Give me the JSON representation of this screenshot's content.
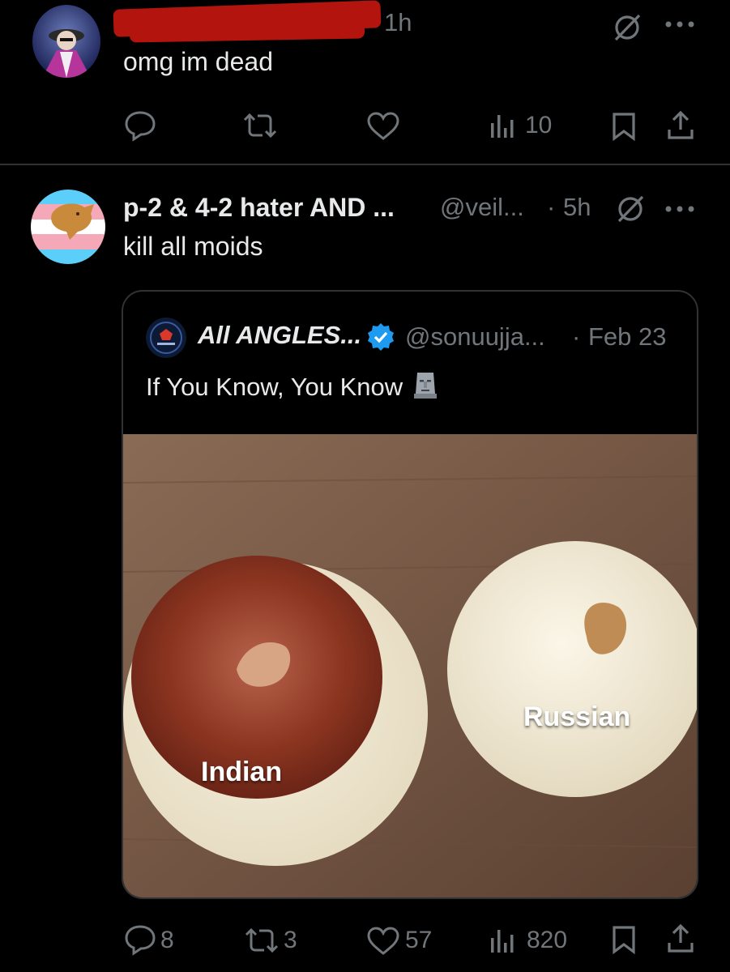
{
  "posts": [
    {
      "time": "1h",
      "text": "omg im dead",
      "actions": {
        "replies": "",
        "reposts": "",
        "likes": "",
        "views": "10"
      }
    },
    {
      "display_name": "p-2 & 4-2 hater AND ...",
      "handle": "@veil...",
      "time_sep": "·",
      "time": "5h",
      "text": "kill all moids",
      "quote": {
        "display_name": "All ANGLES...",
        "handle": "@sonuujja...",
        "time_sep": "·",
        "date": "Feb 23",
        "text": "If You Know, You Know",
        "image_labels": {
          "left": "Indian",
          "right": "Russian"
        }
      },
      "actions": {
        "replies": "8",
        "reposts": "3",
        "likes": "57",
        "views": "820"
      }
    }
  ],
  "icons": {
    "more": "more-icon",
    "grok": "grok-icon",
    "reply": "reply-icon",
    "repost": "repost-icon",
    "like": "like-icon",
    "views": "views-icon",
    "bookmark": "bookmark-icon",
    "share": "share-icon",
    "verified": "verified-badge-icon",
    "moai": "moai-emoji-icon"
  },
  "colors": {
    "background": "#000000",
    "text": "#e7e9ea",
    "muted": "#71767b",
    "border": "#2f3336",
    "verified": "#1d9bf0",
    "redaction": "#b3140d"
  }
}
